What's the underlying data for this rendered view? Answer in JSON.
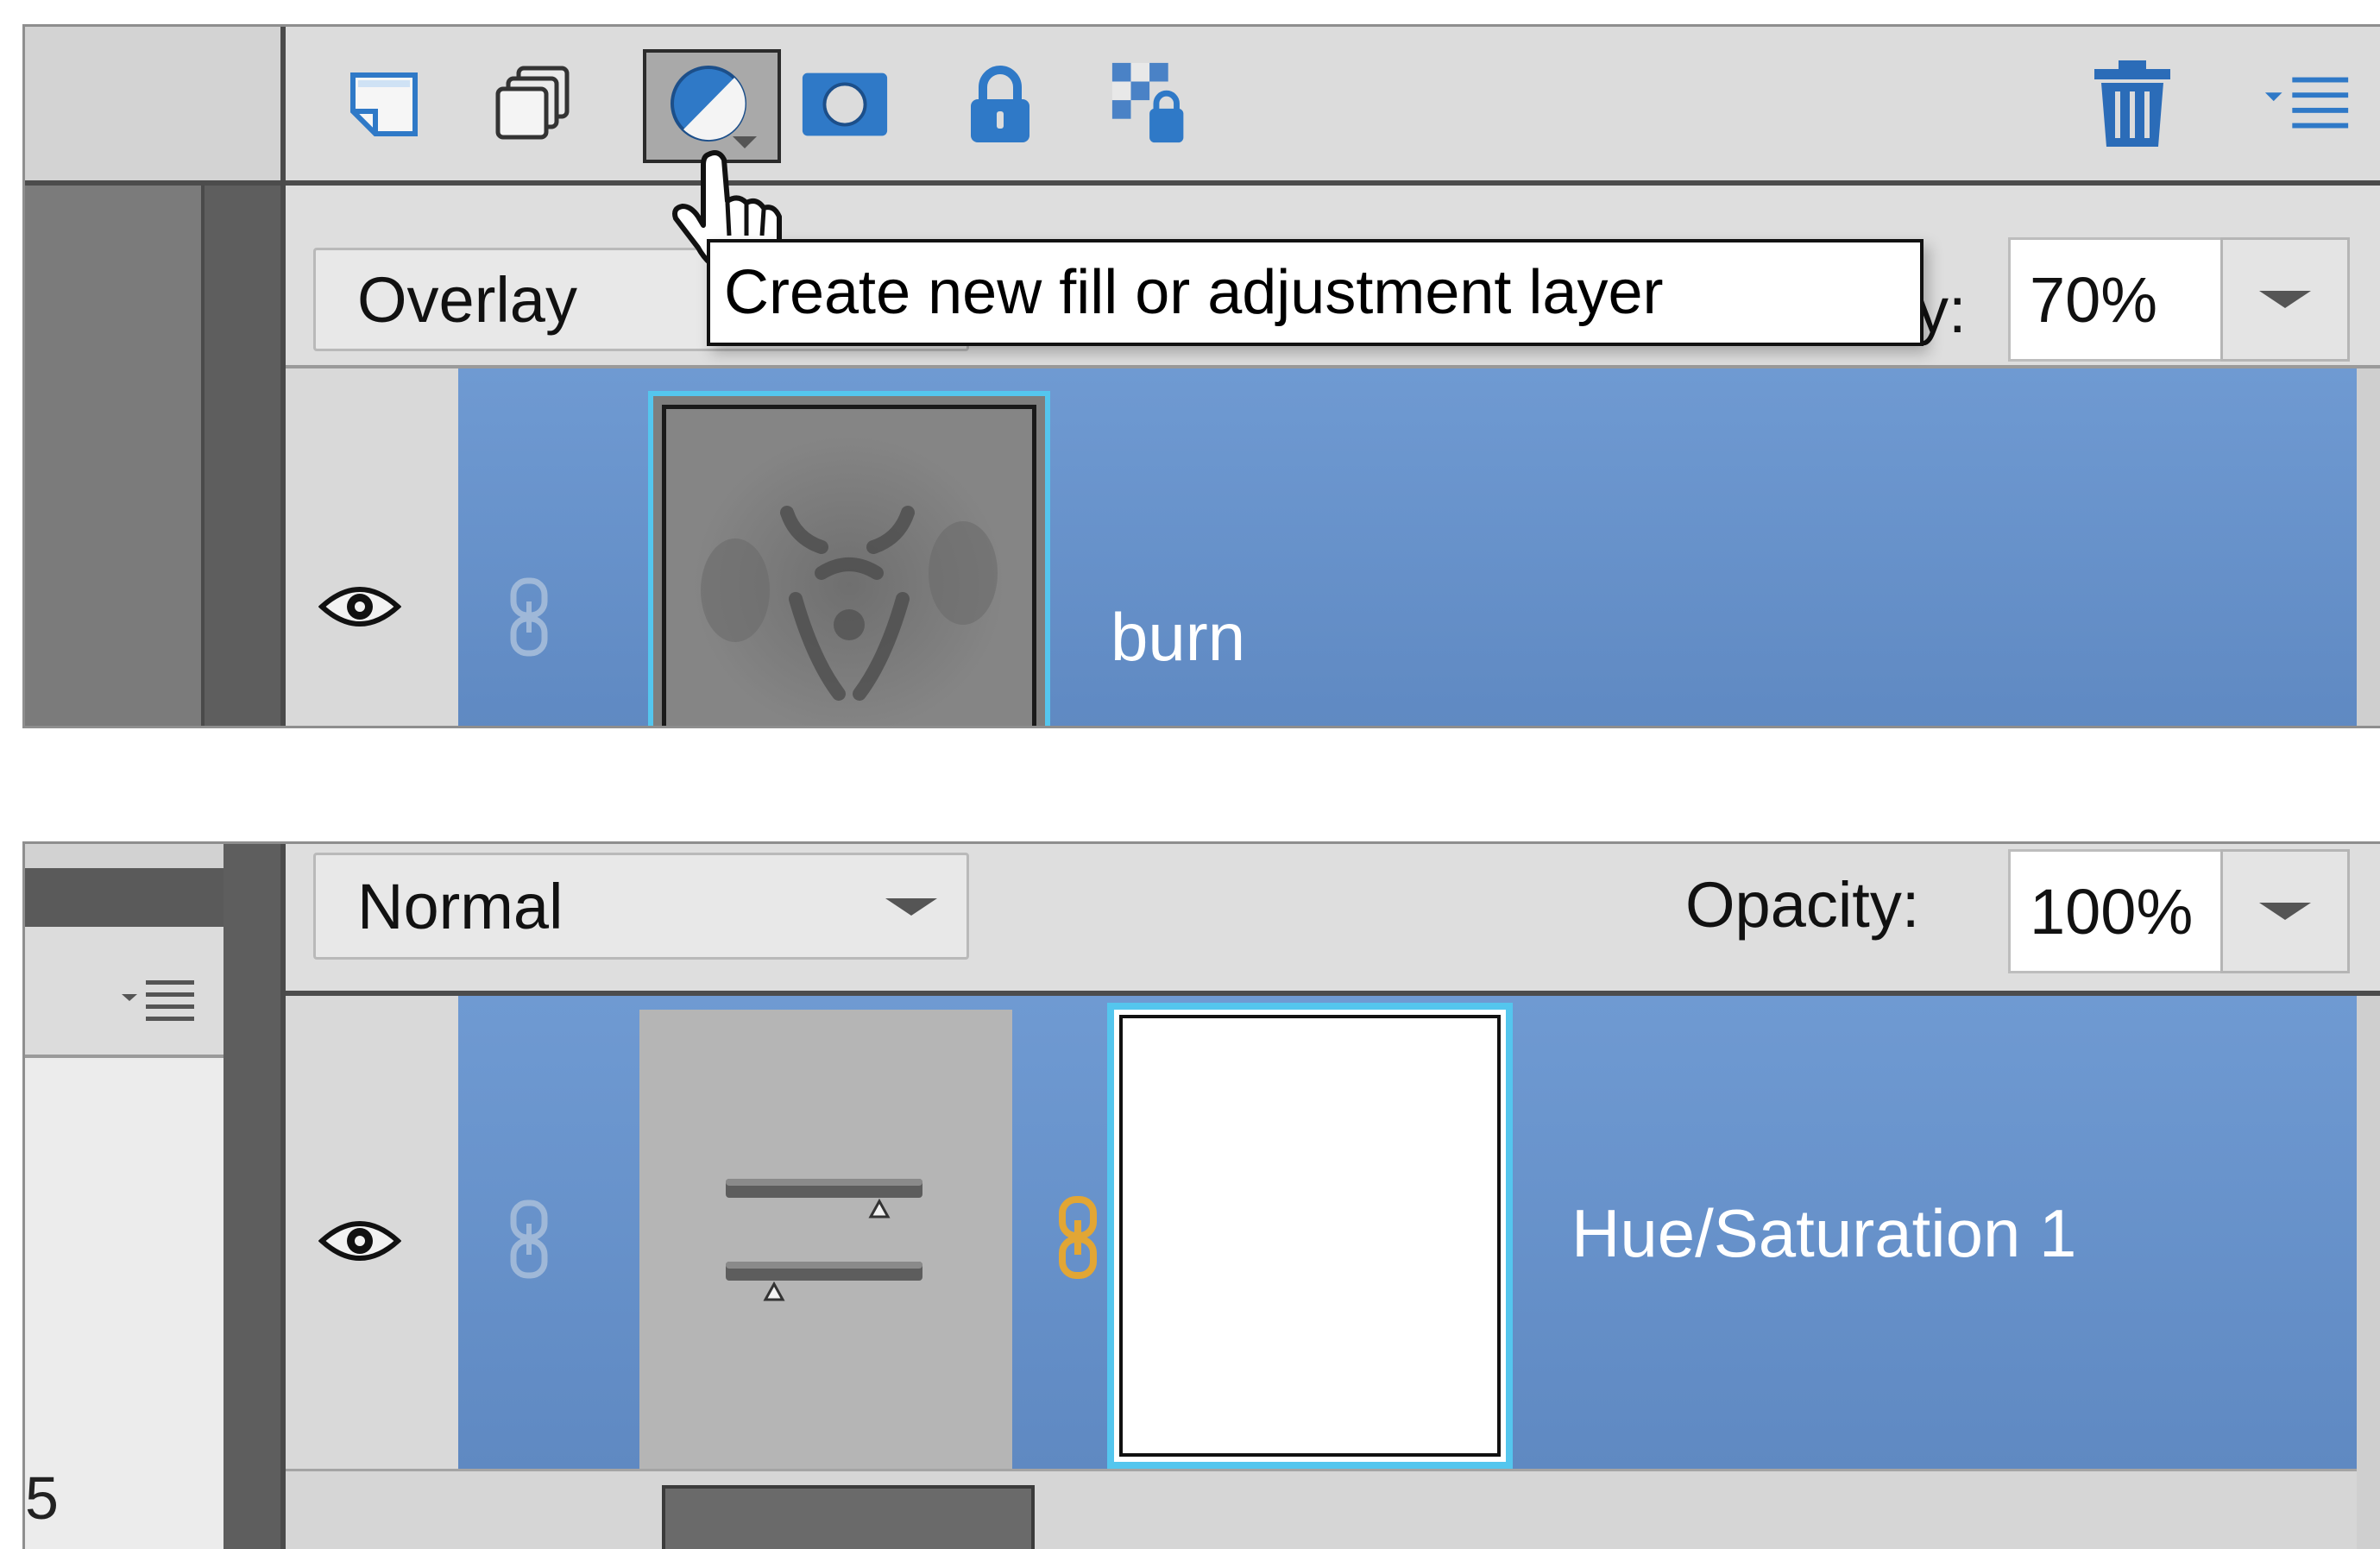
{
  "colors": {
    "layer_selected_bg": "#6a95cd",
    "selection_outline": "#54c6ee",
    "icon_blue": "#2f79c7",
    "trash_blue": "#2b6cb8"
  },
  "top_panel": {
    "toolbar": {
      "tools": [
        {
          "icon": "new-layer-icon"
        },
        {
          "icon": "new-group-icon"
        },
        {
          "icon": "adjustment-layer-icon",
          "selected": true
        },
        {
          "icon": "layer-mask-icon"
        },
        {
          "icon": "lock-all-icon"
        },
        {
          "icon": "lock-transparent-icon"
        }
      ],
      "right_icons": [
        "trash-icon",
        "panel-menu-icon"
      ]
    },
    "blend_mode": "Overlay",
    "opacity_label_fragment": "y:",
    "opacity_value": "70%",
    "tooltip": "Create new fill or adjustment layer",
    "layer": {
      "name": "burn",
      "visible_icon": "eye-icon",
      "link_icon": "link-icon"
    }
  },
  "bottom_panel": {
    "blend_mode": "Normal",
    "opacity_label": "Opacity:",
    "opacity_value": "100%",
    "left_fragment_text": "5",
    "layer": {
      "name": "Hue/Saturation 1",
      "visible_icon": "eye-icon",
      "link_icon": "link-icon",
      "mask_link_icon": "chain-link-icon"
    }
  }
}
